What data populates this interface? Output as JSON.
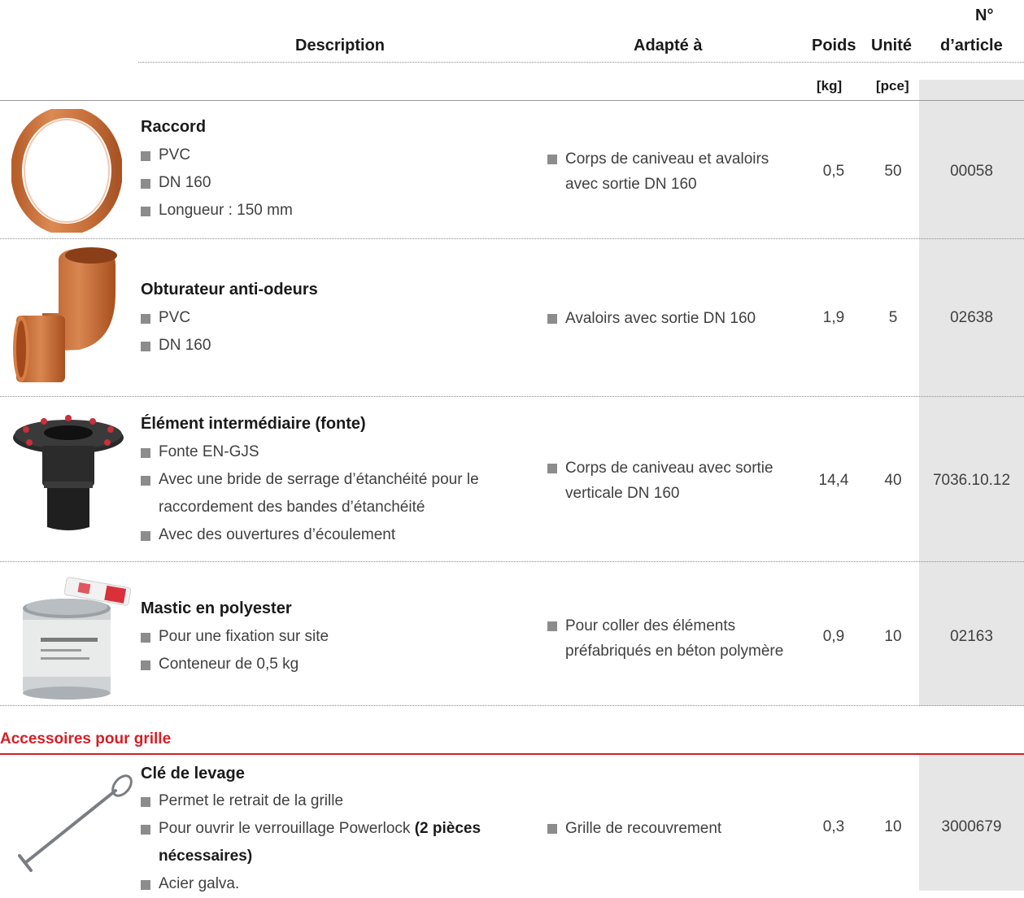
{
  "header": {
    "description": "Description",
    "suitable_for": "Adapté à",
    "weight": "Poids",
    "unit": "Unité",
    "article_line1": "N°",
    "article_line2": "d’article",
    "weight_unit": "[kg]",
    "unit_unit": "[pce]"
  },
  "products": [
    {
      "title": "Raccord",
      "features": [
        "PVC",
        "DN 160",
        "Longueur : 150 mm"
      ],
      "suitable": [
        "Corps de caniveau et avaloirs",
        "avec sortie DN 160"
      ],
      "weight": "0,5",
      "unit": "50",
      "article": "00058",
      "image": "pvc-coupling-ring"
    },
    {
      "title": "Obturateur anti-odeurs",
      "features": [
        "PVC",
        "DN 160"
      ],
      "suitable": [
        "Avaloirs avec sortie DN 160"
      ],
      "weight": "1,9",
      "unit": "5",
      "article": "02638",
      "image": "odour-trap-elbow"
    },
    {
      "title": "Élément intermédiaire (fonte)",
      "features": [
        "Fonte EN-GJS",
        "Avec une bride de serrage d’étanchéité pour le",
        "raccordement des bandes d’étanchéité",
        "Avec des ouvertures d’écoulement"
      ],
      "suitable": [
        "Corps de caniveau avec sortie",
        "verticale DN 160"
      ],
      "weight": "14,4",
      "unit": "40",
      "article": "7036.10.12",
      "image": "cast-iron-intermediate-element"
    },
    {
      "title": "Mastic en polyester",
      "features": [
        "Pour une fixation sur site",
        "Conteneur de 0,5 kg"
      ],
      "suitable": [
        "Pour coller des éléments",
        "préfabriqués en béton polymère"
      ],
      "weight": "0,9",
      "unit": "10",
      "article": "02163",
      "image": "polyester-mastic-can"
    }
  ],
  "section_title": "Accessoires pour grille",
  "accessory": {
    "title": "Clé de levage",
    "features": [
      "Permet le retrait de la grille",
      "Pour ouvrir le verrouillage Powerlock",
      "(2 pièces",
      "nécessaires)",
      "Acier galva."
    ],
    "suitable": [
      "Grille de recouvrement"
    ],
    "weight": "0,3",
    "unit": "10",
    "article": "3000679",
    "image": "lifting-key"
  },
  "colors": {
    "accent_red": "#d41f27",
    "article_column_bg": "#e6e6e6",
    "pvc_orange": "#c8703a"
  }
}
